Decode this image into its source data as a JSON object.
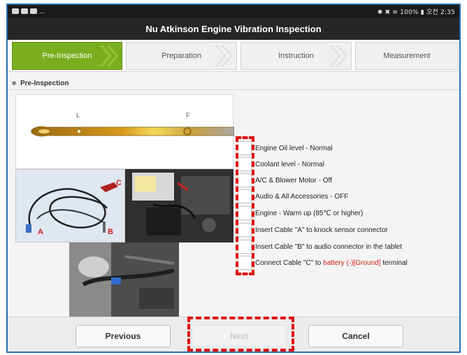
{
  "status_bar": {
    "left_text": "...",
    "right_text": "✱ ✖ ≋ 100% ▮ 오전 2:35"
  },
  "title": "Nu Atkinson Engine Vibration Inspection",
  "tabs": [
    {
      "label": "Pre-Inspection",
      "active": true
    },
    {
      "label": "Preparation",
      "active": false
    },
    {
      "label": "Instruction",
      "active": false
    },
    {
      "label": "Measurement",
      "active": false
    }
  ],
  "section_title": "Pre-Inspection",
  "images": {
    "dipstick": {
      "label_l": "L",
      "label_f": "F"
    },
    "cable": {
      "label_a": "A",
      "label_b": "B",
      "label_c": "C"
    },
    "engine": {},
    "connector": {}
  },
  "checklist": [
    {
      "text": "Engine Oil level - Normal"
    },
    {
      "text": "Coolant level - Normal"
    },
    {
      "text": "A/C & Blower Motor - Off"
    },
    {
      "text": "Audio & All Accessories - OFF"
    },
    {
      "text": "Engine - Warm up (85℃ or higher)"
    },
    {
      "text": "Insert Cable \"A\" to knock sensor connector"
    },
    {
      "text": "Insert Cable \"B\" to audio connector in the tablet"
    },
    {
      "text_before": "Connect Cable \"C\" to ",
      "text_red": "battery (-)[Ground]",
      "text_after": " terminal"
    }
  ],
  "buttons": {
    "previous": "Previous",
    "next": "Next",
    "cancel": "Cancel"
  },
  "colors": {
    "active_tab": "#7aae1e",
    "title_bar": "#262626",
    "highlight": "#e01010",
    "red_text": "#d0201c"
  }
}
